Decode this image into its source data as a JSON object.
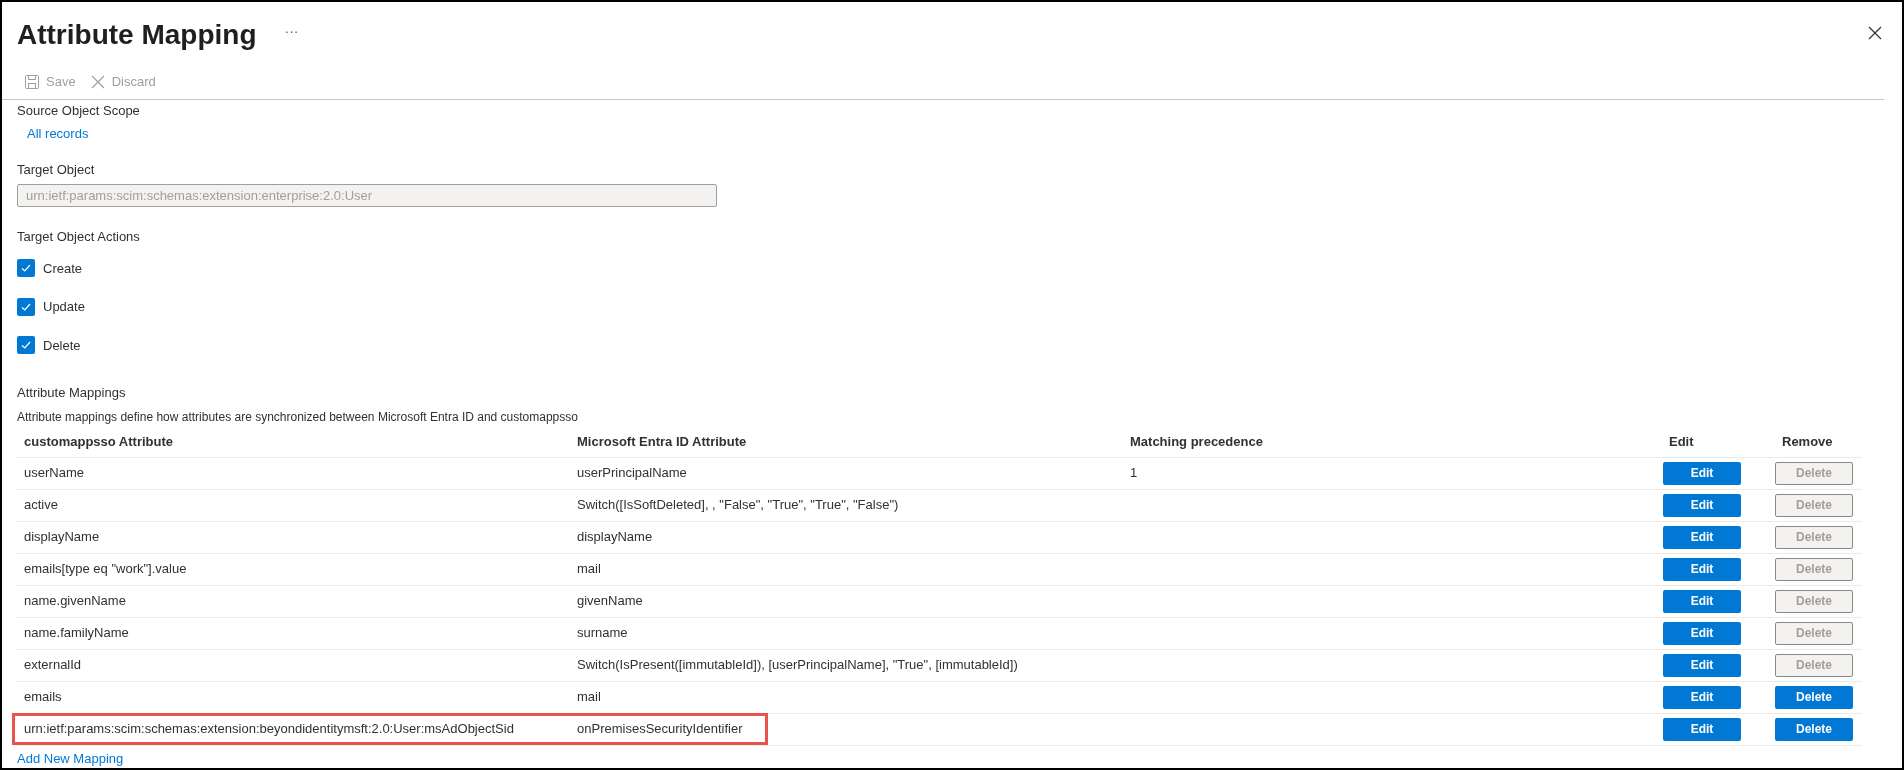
{
  "title": "Attribute Mapping",
  "more": "···",
  "toolbar": [
    {
      "kind": "save",
      "label": "Save",
      "disabled": true
    },
    {
      "kind": "discard",
      "label": "Discard",
      "disabled": true
    }
  ],
  "source_scope": {
    "label": "Source Object Scope",
    "value": "All records"
  },
  "target_object": {
    "label": "Target Object",
    "value": "urn:ietf:params:scim:schemas:extension:enterprise:2.0:User",
    "disabled": true
  },
  "actions": {
    "label": "Target Object Actions",
    "items": [
      {
        "label": "Create",
        "checked": true
      },
      {
        "label": "Update",
        "checked": true
      },
      {
        "label": "Delete",
        "checked": true
      }
    ]
  },
  "mappings": {
    "title": "Attribute Mappings",
    "description": "Attribute mappings define how attributes are synchronized between Microsoft Entra ID and customappsso",
    "columns": [
      "customappsso Attribute",
      "Microsoft Entra ID Attribute",
      "Matching precedence",
      "Edit",
      "Remove"
    ],
    "rows": [
      {
        "attribute": "userName",
        "source": "userPrincipalName",
        "precedence": "1",
        "edit": "Edit",
        "delete": "Delete",
        "delete_disabled": true,
        "highlighted": false
      },
      {
        "attribute": "active",
        "source": "Switch([IsSoftDeleted], , \"False\", \"True\", \"True\", \"False\")",
        "edit": "Edit",
        "delete": "Delete",
        "delete_disabled": true,
        "highlighted": false
      },
      {
        "attribute": "displayName",
        "source": "displayName",
        "edit": "Edit",
        "delete": "Delete",
        "delete_disabled": true,
        "highlighted": false
      },
      {
        "attribute": "emails[type eq \"work\"].value",
        "source": "mail",
        "edit": "Edit",
        "delete": "Delete",
        "delete_disabled": true,
        "highlighted": false
      },
      {
        "attribute": "name.givenName",
        "source": "givenName",
        "edit": "Edit",
        "delete": "Delete",
        "delete_disabled": true,
        "highlighted": false
      },
      {
        "attribute": "name.familyName",
        "source": "surname",
        "edit": "Edit",
        "delete": "Delete",
        "delete_disabled": true,
        "highlighted": false
      },
      {
        "attribute": "externalId",
        "source": "Switch(IsPresent([immutableId]), [userPrincipalName], \"True\", [immutableId])",
        "edit": "Edit",
        "delete": "Delete",
        "delete_disabled": true,
        "highlighted": false
      },
      {
        "attribute": "emails",
        "source": "mail",
        "edit": "Edit",
        "delete": "Delete",
        "delete_disabled": false,
        "highlighted": false
      },
      {
        "attribute": "urn:ietf:params:scim:schemas:extension:beyondidentitymsft:2.0:User:msAdObjectSid",
        "source": "onPremisesSecurityIdentifier",
        "edit": "Edit",
        "delete": "Delete",
        "delete_disabled": false,
        "highlighted": true
      }
    ],
    "add_link": "Add New Mapping"
  }
}
